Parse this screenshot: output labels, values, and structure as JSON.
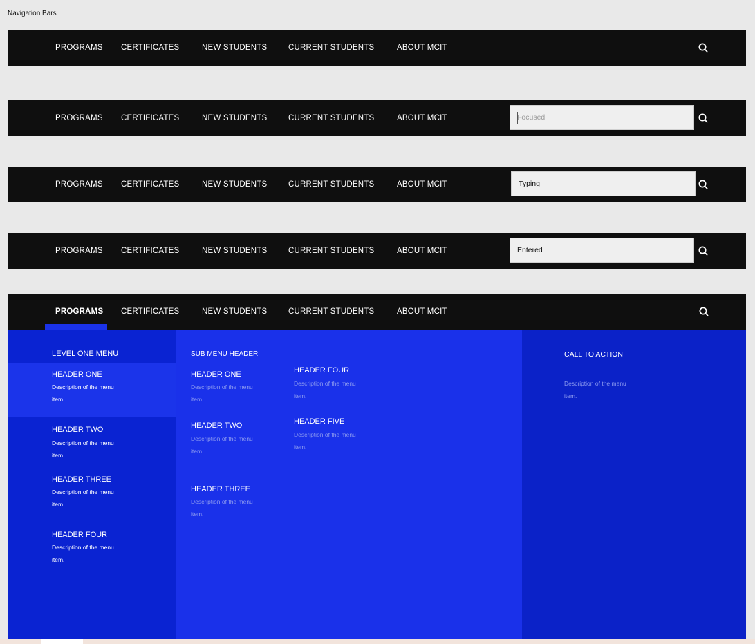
{
  "page_title": "Navigation Bars",
  "nav_items": [
    "PROGRAMS",
    "CERTIFICATES",
    "NEW STUDENTS",
    "CURRENT STUDENTS",
    "ABOUT MCIT"
  ],
  "search_icon": "search-icon",
  "states": {
    "focused_placeholder": "Focused",
    "typing_value": "Typing",
    "entered_value": "Entered"
  },
  "mega_menu": {
    "level_one_title": "LEVEL ONE  MENU",
    "level_one_items": [
      {
        "header": "HEADER ONE",
        "desc": "Description of the menu item."
      },
      {
        "header": "HEADER TWO",
        "desc": "Description of the menu item."
      },
      {
        "header": "HEADER THREE",
        "desc": "Description of the menu item."
      },
      {
        "header": "HEADER FOUR",
        "desc": "Description of the menu item."
      }
    ],
    "sub_menu_title": "SUB MENU HEADER",
    "sub_menu_col_a": [
      {
        "header": "HEADER ONE",
        "desc": "Description of the menu item."
      },
      {
        "header": "HEADER TWO",
        "desc": "Description of the menu item."
      },
      {
        "header": "HEADER THREE",
        "desc": "Description of the menu item."
      }
    ],
    "sub_menu_col_b": [
      {
        "header": "HEADER FOUR",
        "desc": "Description of the menu item."
      },
      {
        "header": "HEADER FIVE",
        "desc": "Description of the menu item."
      }
    ],
    "cta_title": "CALL TO ACTION",
    "cta_desc": "Description of the menu item."
  },
  "colors": {
    "background": "#e9e9e9",
    "nav_bg": "#0f0f0f",
    "menu_primary": "#0a23d2",
    "menu_highlight": "#1b34ea",
    "menu_secondary": "#1a31ea"
  }
}
